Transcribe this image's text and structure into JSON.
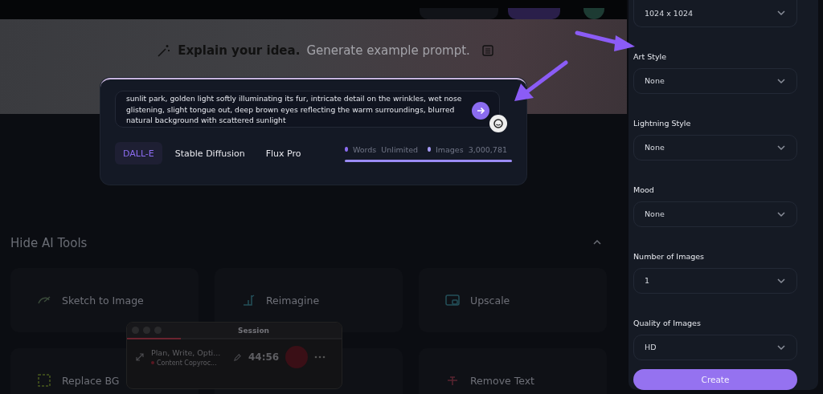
{
  "banner": {
    "heading": "Explain your idea.",
    "link": "Generate example prompt."
  },
  "prompt": {
    "value": "sunlit park, golden light softly illuminating its fur, intricate detail on the wrinkles, wet nose glistening, slight tongue out, deep brown eyes reflecting the warm surroundings, blurred natural background with scattered sunlight",
    "models": [
      {
        "label": "DALL-E",
        "selected": true
      },
      {
        "label": "Stable Diffusion",
        "selected": false
      },
      {
        "label": "Flux Pro",
        "selected": false
      }
    ],
    "stats": [
      {
        "label": "Words",
        "value": "Unlimited"
      },
      {
        "label": "Images",
        "value": "3,000,781"
      }
    ],
    "usage": {
      "level": 1
    }
  },
  "tools": {
    "title": "Hide AI Tools",
    "expanded": true,
    "items": [
      {
        "kind": "sketch",
        "label": "Sketch to Image"
      },
      {
        "kind": "reimagine",
        "label": "Reimagine"
      },
      {
        "kind": "upscale",
        "label": "Upscale"
      },
      {
        "kind": "replace",
        "label": "Replace BG"
      },
      {
        "kind": "covered"
      },
      {
        "kind": "remove",
        "label": "Remove Text"
      }
    ]
  },
  "session": {
    "title": "Session",
    "task": "Plan, Write, Opti...",
    "project": "Content Copyroc...",
    "timer": "44:56",
    "progress": {
      "level": 0.25
    }
  },
  "settings": {
    "fields": [
      {
        "value": "1024 x 1024"
      },
      {
        "label": "Art Style",
        "value": "None"
      },
      {
        "label": "Lightning Style",
        "value": "None"
      },
      {
        "label": "Mood",
        "value": "None"
      },
      {
        "label": "Number of Images",
        "value": "1"
      },
      {
        "label": "Quality of Images",
        "value": "HD"
      }
    ],
    "button": "Create"
  }
}
